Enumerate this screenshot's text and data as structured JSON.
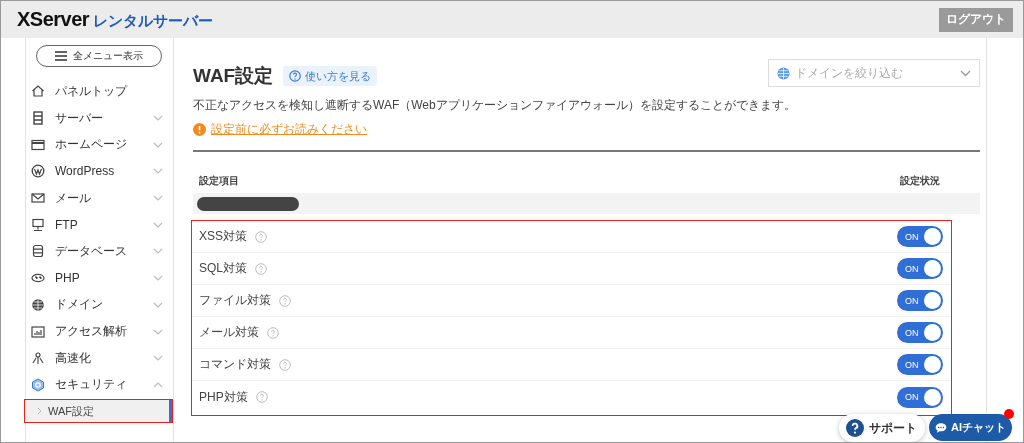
{
  "header": {
    "logo_brand": "XServer",
    "logo_product": "レンタルサーバー",
    "logout": "ログアウト"
  },
  "sidebar": {
    "menu_button": "全メニュー表示",
    "items": [
      {
        "label": "パネルトップ",
        "kind": "link"
      },
      {
        "label": "サーバー",
        "kind": "group",
        "expanded": false
      },
      {
        "label": "ホームページ",
        "kind": "group",
        "expanded": false
      },
      {
        "label": "WordPress",
        "kind": "group",
        "expanded": false
      },
      {
        "label": "メール",
        "kind": "group",
        "expanded": false
      },
      {
        "label": "FTP",
        "kind": "group",
        "expanded": false
      },
      {
        "label": "データベース",
        "kind": "group",
        "expanded": false
      },
      {
        "label": "PHP",
        "kind": "group",
        "expanded": false
      },
      {
        "label": "ドメイン",
        "kind": "group",
        "expanded": false
      },
      {
        "label": "アクセス解析",
        "kind": "group",
        "expanded": false
      },
      {
        "label": "高速化",
        "kind": "group",
        "expanded": false
      },
      {
        "label": "セキュリティ",
        "kind": "group",
        "expanded": true,
        "children": [
          {
            "label": "WAF設定",
            "selected": true,
            "highlighted": true
          }
        ]
      }
    ]
  },
  "page": {
    "title": "WAF設定",
    "help_link": "使い方を見る",
    "domain_filter": {
      "placeholder": "ドメインを絞り込む"
    },
    "description": "不正なアクセスを検知し遮断するWAF（Webアプリケーションファイアウォール）を設定することができます。",
    "warning_link": "設定前に必ずお読みください"
  },
  "table": {
    "columns": [
      "設定項目",
      "設定状況"
    ],
    "highlighted": true,
    "rows": [
      {
        "label": "XSS対策",
        "on": true,
        "state_label": "ON"
      },
      {
        "label": "SQL対策",
        "on": true,
        "state_label": "ON"
      },
      {
        "label": "ファイル対策",
        "on": true,
        "state_label": "ON"
      },
      {
        "label": "メール対策",
        "on": true,
        "state_label": "ON"
      },
      {
        "label": "コマンド対策",
        "on": true,
        "state_label": "ON"
      },
      {
        "label": "PHP対策",
        "on": true,
        "state_label": "ON"
      }
    ]
  },
  "floating": {
    "support": "サポート",
    "chat": "AIチャット",
    "chat_notification": true
  }
}
